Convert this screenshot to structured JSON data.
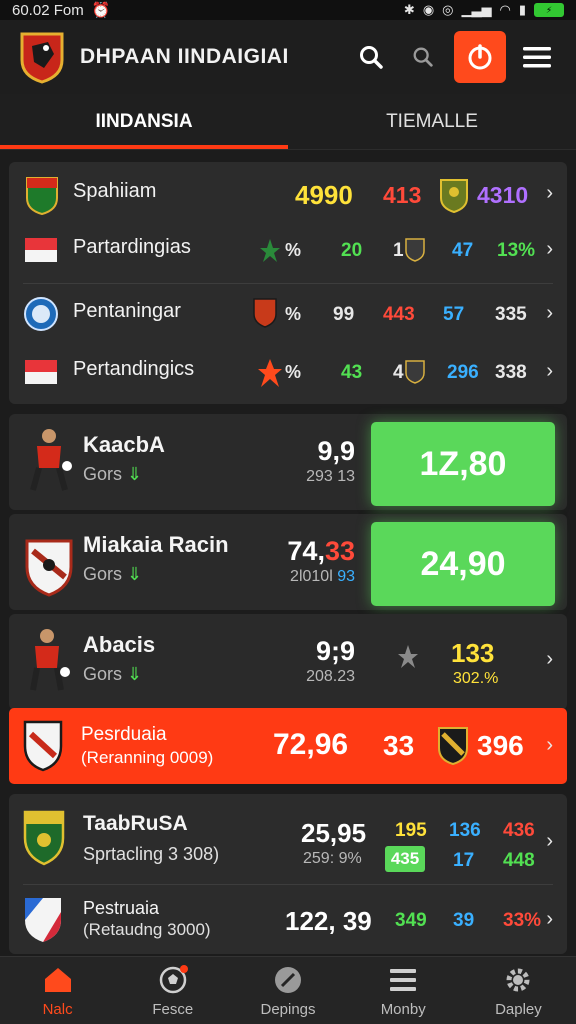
{
  "status": {
    "time": "60.02 Fom"
  },
  "app": {
    "title": "DHPAAN IINDAIGIAI"
  },
  "tabs": [
    {
      "label": "IINDANSIA"
    },
    {
      "label": "TIEMALLE"
    }
  ],
  "table": [
    {
      "name": "Spahiiam",
      "values": [
        "4990",
        "413",
        "4310"
      ]
    },
    {
      "name": "Partardingias",
      "values": [
        "%",
        "20",
        "1",
        "47",
        "13%"
      ]
    },
    {
      "name": "Pentaningar",
      "values": [
        "%",
        "99",
        "443",
        "57",
        "335"
      ]
    },
    {
      "name": "Pertandingics",
      "values": [
        "%",
        "43",
        "4",
        "296",
        "338"
      ]
    }
  ],
  "matches": [
    {
      "name": "KaacbA",
      "sub": "Gors",
      "score": "9,9",
      "score2": "293 13",
      "button": "1Z,80"
    },
    {
      "name": "Miakaia Racin",
      "sub": "Gors",
      "score_a": "74,",
      "score_b": "33",
      "score2_a": "2l010l",
      "score2_b": "93",
      "button": "24,90"
    },
    {
      "name": "Abacis",
      "sub": "Gors",
      "score": "9;9",
      "score2": "208.23",
      "odd": "133",
      "odd_pct": "302.%"
    }
  ],
  "promo": {
    "title": "Pesrduaia",
    "sub": "(Reranning 0009)",
    "v1": "72,96",
    "v2": "33",
    "v3": "396"
  },
  "bottom_list": [
    {
      "name": "TaabRuSA",
      "sub": "Sprtacling 3 308)",
      "score": "25,95",
      "score2": "259: 9%",
      "top": [
        "195",
        "136",
        "436"
      ],
      "bottom": [
        "435",
        "17",
        "448"
      ]
    },
    {
      "name": "Pestruaia",
      "sub": "(Retaudng 3000)",
      "score": "122, 39",
      "vals": [
        "349",
        "39",
        "33%"
      ]
    }
  ],
  "nav": [
    {
      "label": "Nalc"
    },
    {
      "label": "Fesce"
    },
    {
      "label": "Depings"
    },
    {
      "label": "Monby"
    },
    {
      "label": "Dapley"
    }
  ],
  "colors": {
    "accent": "#ff3a14",
    "green": "#5ad85a",
    "yellow": "#ffe23a",
    "red": "#ff4a3a",
    "purple": "#b070ff",
    "blue": "#3ab0ff",
    "lime": "#52e052"
  }
}
